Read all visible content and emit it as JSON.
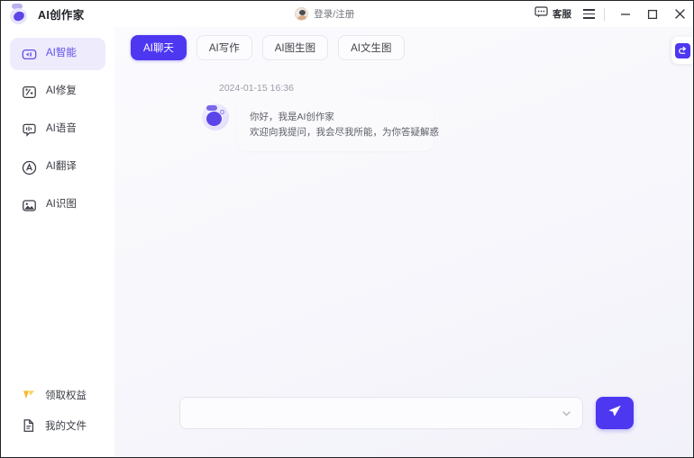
{
  "window": {
    "title": "AI创作家",
    "logo_icon": "ai-creator-logo-icon",
    "login_label": "登录/注册",
    "avatar_icon": "user-avatar-icon",
    "support_label": "客服",
    "support_icon": "chat-bubble-icon",
    "menu_icon": "hamburger-menu-icon",
    "minimize_icon": "minimize-icon",
    "maximize_icon": "maximize-icon",
    "close_icon": "close-icon"
  },
  "sidebar": {
    "items": [
      {
        "label": "AI智能",
        "icon": "ai-smart-icon",
        "active": true
      },
      {
        "label": "AI修复",
        "icon": "ai-repair-icon",
        "active": false
      },
      {
        "label": "AI语音",
        "icon": "ai-voice-icon",
        "active": false
      },
      {
        "label": "AI翻译",
        "icon": "ai-translate-icon",
        "active": false
      },
      {
        "label": "AI识图",
        "icon": "ai-image-recognize-icon",
        "active": false
      }
    ],
    "bottom_items": [
      {
        "label": "领取权益",
        "icon": "benefits-crown-icon"
      },
      {
        "label": "我的文件",
        "icon": "my-files-icon"
      }
    ]
  },
  "main": {
    "tabs": [
      {
        "label": "AI聊天",
        "active": true
      },
      {
        "label": "AI写作",
        "active": false
      },
      {
        "label": "AI图生图",
        "active": false
      },
      {
        "label": "AI文生图",
        "active": false
      }
    ],
    "message": {
      "timestamp": "2024-01-15 16:36",
      "avatar_icon": "bot-avatar-icon",
      "line1": "你好，我是AI创作家",
      "line2": "欢迎向我提问，我会尽我所能，为你答疑解惑"
    },
    "composer": {
      "input_value": "",
      "input_placeholder": "",
      "dropdown_icon": "chevron-down-icon",
      "send_icon": "send-paper-plane-icon"
    },
    "side_tab": {
      "icon": "history-undo-icon"
    }
  },
  "colors": {
    "accent": "#4d37f0",
    "accent_soft": "#eeebfd",
    "accent_text": "#6050e6",
    "benefits": "#f5a623",
    "main_bg": "#f6f5fb"
  }
}
